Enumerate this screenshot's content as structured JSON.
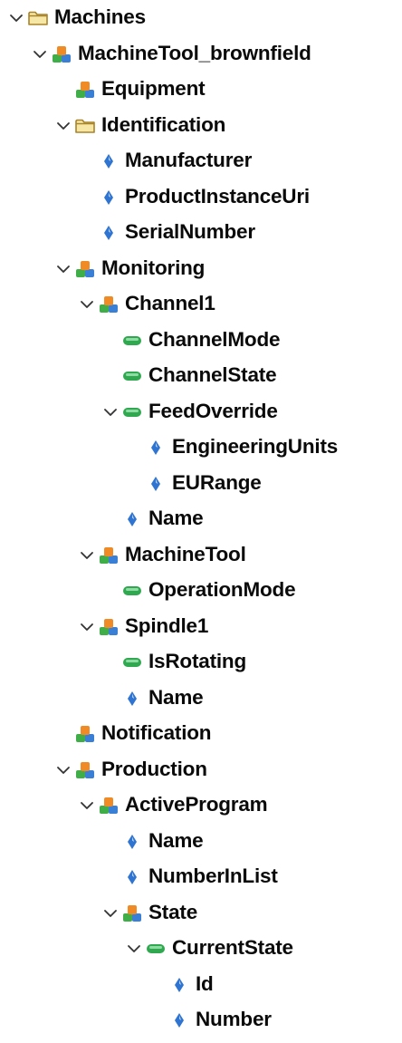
{
  "tree": [
    {
      "label": "Machines",
      "icon": "folder-icon",
      "level": 0,
      "expanded": true
    },
    {
      "label": "MachineTool_brownfield",
      "icon": "object-icon",
      "level": 1,
      "expanded": true
    },
    {
      "label": "Equipment",
      "icon": "object-icon",
      "level": 2
    },
    {
      "label": "Identification",
      "icon": "folder-icon",
      "level": 2,
      "expanded": true
    },
    {
      "label": "Manufacturer",
      "icon": "property-icon",
      "level": 3
    },
    {
      "label": "ProductInstanceUri",
      "icon": "property-icon",
      "level": 3
    },
    {
      "label": "SerialNumber",
      "icon": "property-icon",
      "level": 3
    },
    {
      "label": "Monitoring",
      "icon": "object-icon",
      "level": 2,
      "expanded": true
    },
    {
      "label": "Channel1",
      "icon": "object-icon",
      "level": 3,
      "expanded": true
    },
    {
      "label": "ChannelMode",
      "icon": "variable-icon",
      "level": 4
    },
    {
      "label": "ChannelState",
      "icon": "variable-icon",
      "level": 4
    },
    {
      "label": "FeedOverride",
      "icon": "variable-icon",
      "level": 4,
      "expanded": true
    },
    {
      "label": "EngineeringUnits",
      "icon": "property-icon",
      "level": 5
    },
    {
      "label": "EURange",
      "icon": "property-icon",
      "level": 5
    },
    {
      "label": "Name",
      "icon": "property-icon",
      "level": 4
    },
    {
      "label": "MachineTool",
      "icon": "object-icon",
      "level": 3,
      "expanded": true
    },
    {
      "label": "OperationMode",
      "icon": "variable-icon",
      "level": 4
    },
    {
      "label": "Spindle1",
      "icon": "object-icon",
      "level": 3,
      "expanded": true
    },
    {
      "label": "IsRotating",
      "icon": "variable-icon",
      "level": 4
    },
    {
      "label": "Name",
      "icon": "property-icon",
      "level": 4
    },
    {
      "label": "Notification",
      "icon": "object-icon",
      "level": 2
    },
    {
      "label": "Production",
      "icon": "object-icon",
      "level": 2,
      "expanded": true
    },
    {
      "label": "ActiveProgram",
      "icon": "object-icon",
      "level": 3,
      "expanded": true
    },
    {
      "label": "Name",
      "icon": "property-icon",
      "level": 4
    },
    {
      "label": "NumberInList",
      "icon": "property-icon",
      "level": 4
    },
    {
      "label": "State",
      "icon": "object-icon",
      "level": 4,
      "expanded": true
    },
    {
      "label": "CurrentState",
      "icon": "variable-icon",
      "level": 5,
      "expanded": true
    },
    {
      "label": "Id",
      "icon": "property-icon",
      "level": 6
    },
    {
      "label": "Number",
      "icon": "property-icon",
      "level": 6
    }
  ],
  "colors": {
    "folder_outline": "#a8842a",
    "folder_fill": "#f7e7a6",
    "object_orange": "#f08a24",
    "object_blue": "#3a7fd6",
    "object_green": "#3fae49",
    "property_blue": "#2f74d0",
    "variable_green": "#2fa84f"
  }
}
